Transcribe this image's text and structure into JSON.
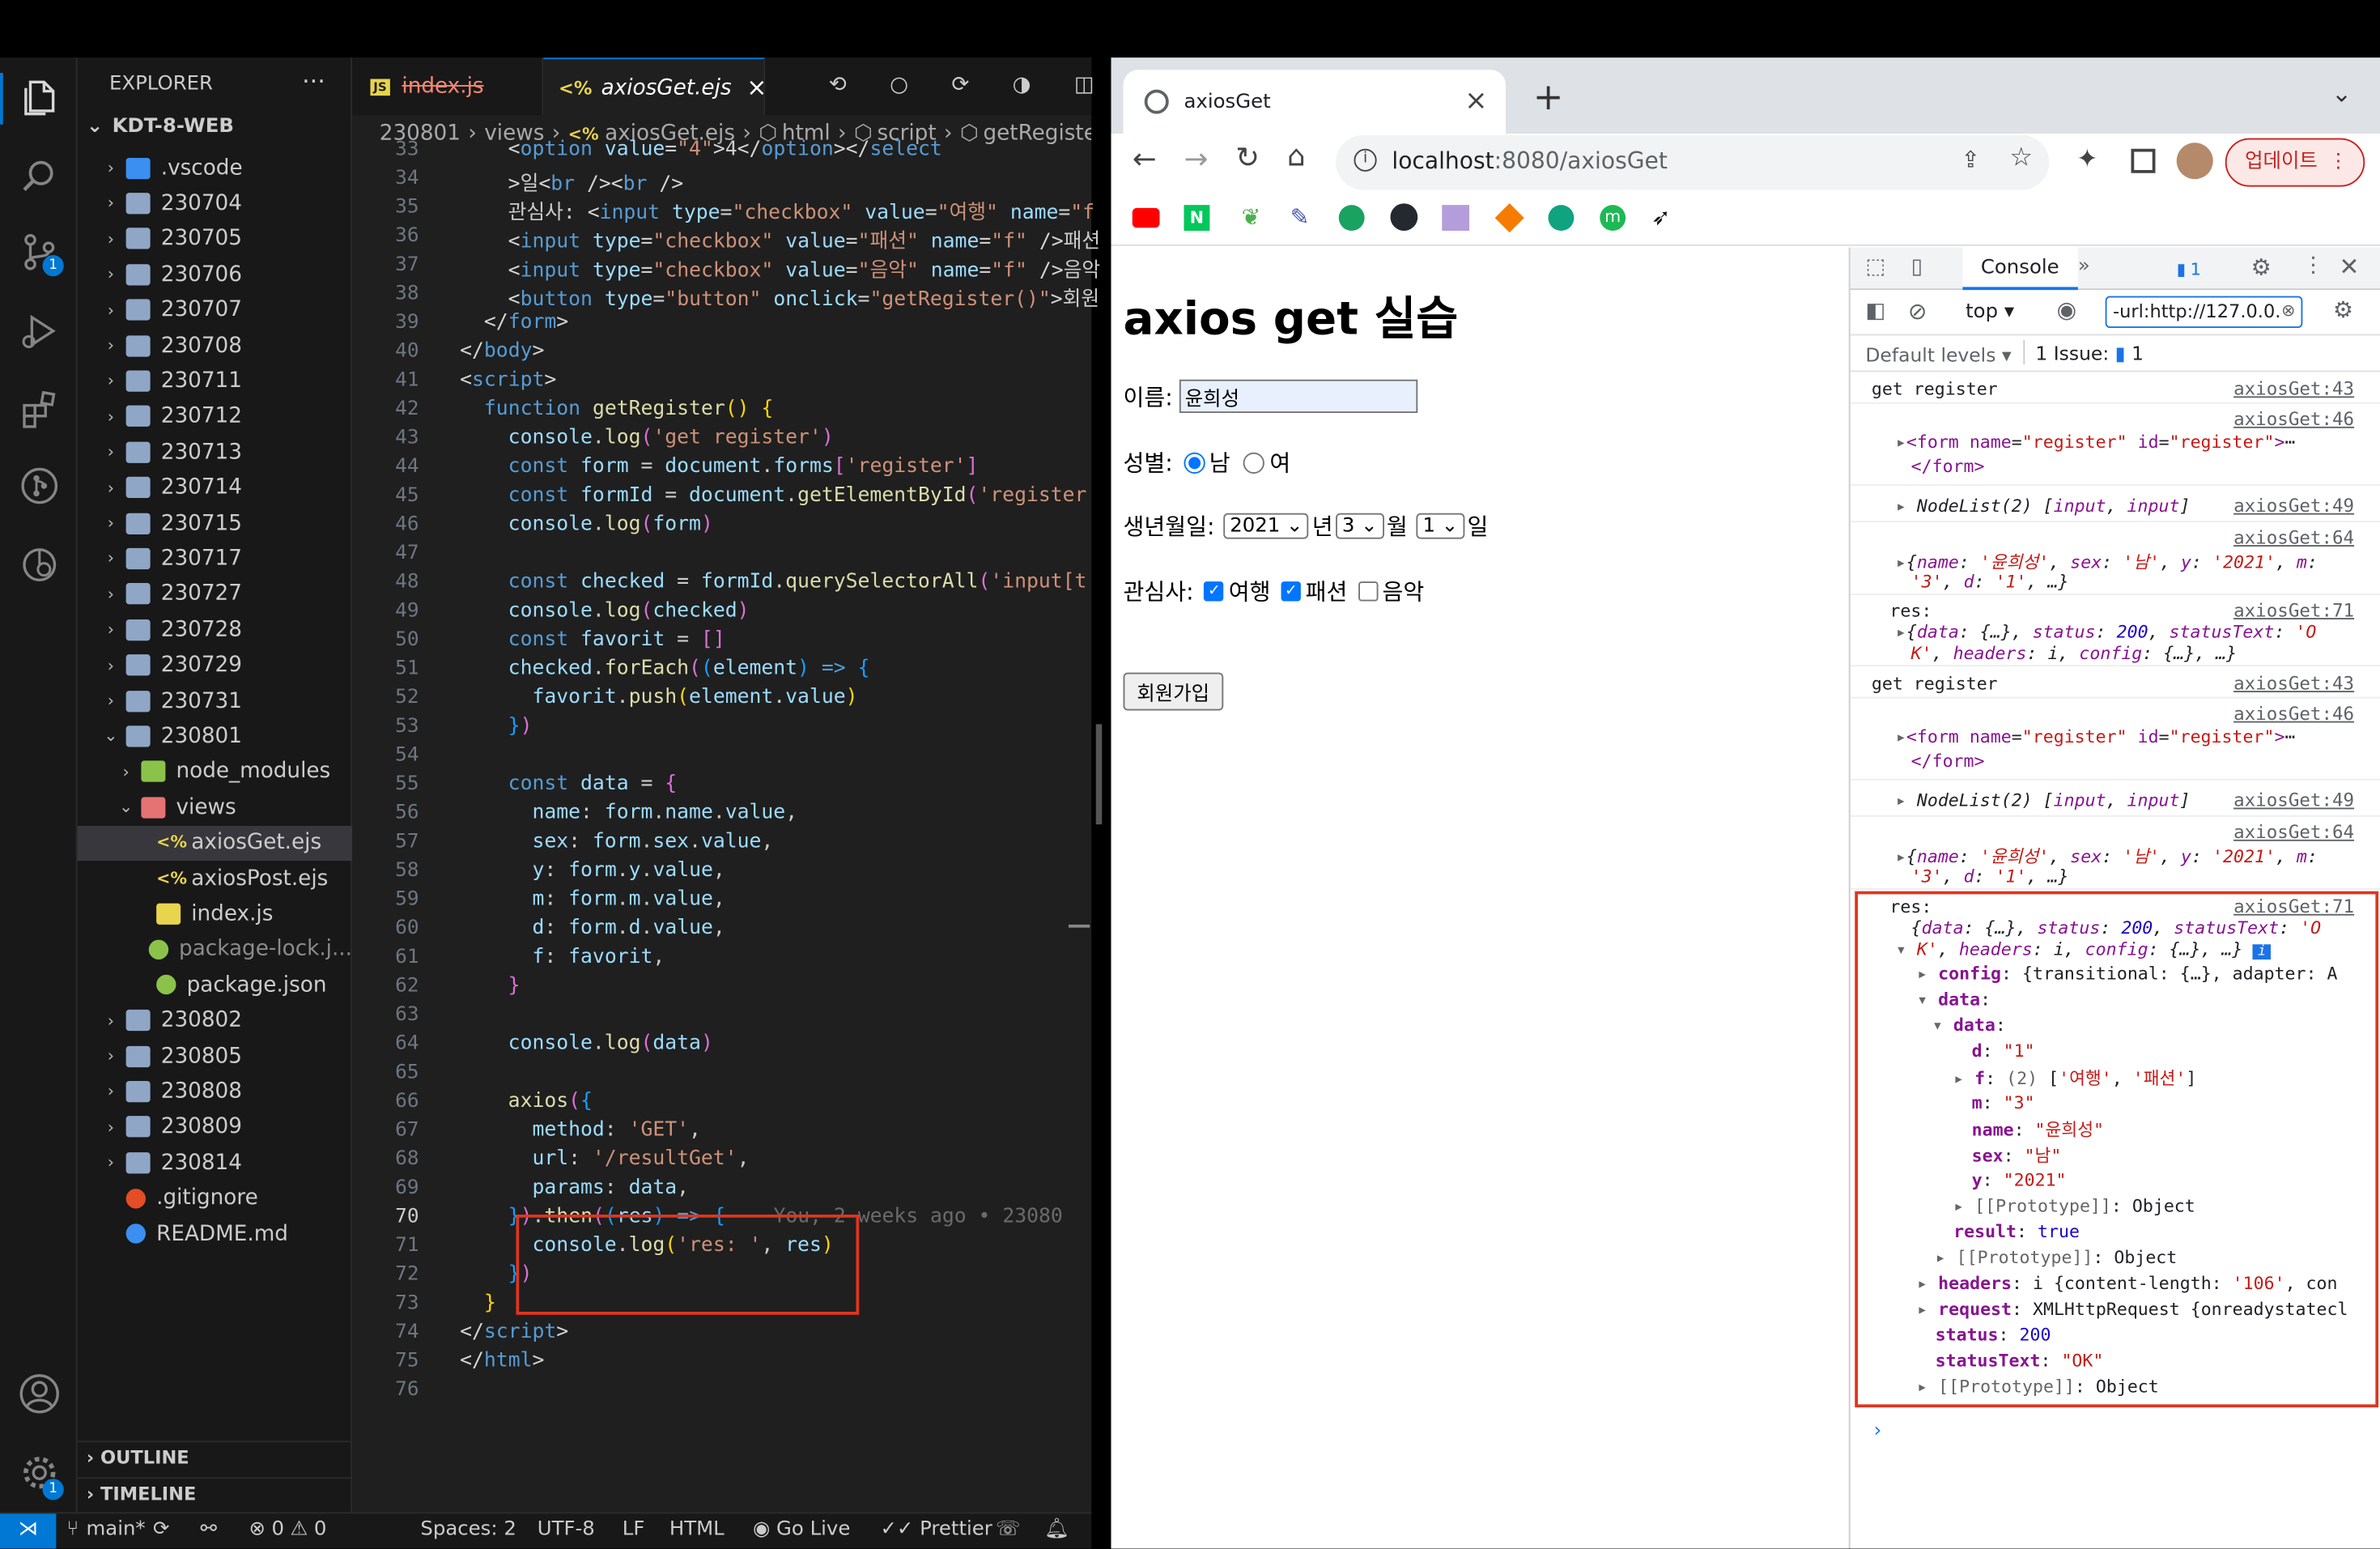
{
  "vscode": {
    "explorer": {
      "title": "EXPLORER",
      "root": "KDT-8-WEB",
      "items": [
        {
          "label": ".vscode",
          "kind": "folder-vscode",
          "depth": 1,
          "open": false
        },
        {
          "label": "230704",
          "kind": "folder",
          "depth": 1,
          "open": false
        },
        {
          "label": "230705",
          "kind": "folder",
          "depth": 1,
          "open": false
        },
        {
          "label": "230706",
          "kind": "folder",
          "depth": 1,
          "open": false
        },
        {
          "label": "230707",
          "kind": "folder",
          "depth": 1,
          "open": false
        },
        {
          "label": "230708",
          "kind": "folder",
          "depth": 1,
          "open": false
        },
        {
          "label": "230711",
          "kind": "folder",
          "depth": 1,
          "open": false
        },
        {
          "label": "230712",
          "kind": "folder",
          "depth": 1,
          "open": false
        },
        {
          "label": "230713",
          "kind": "folder",
          "depth": 1,
          "open": false
        },
        {
          "label": "230714",
          "kind": "folder",
          "depth": 1,
          "open": false
        },
        {
          "label": "230715",
          "kind": "folder",
          "depth": 1,
          "open": false
        },
        {
          "label": "230717",
          "kind": "folder",
          "depth": 1,
          "open": false
        },
        {
          "label": "230727",
          "kind": "folder",
          "depth": 1,
          "open": false
        },
        {
          "label": "230728",
          "kind": "folder",
          "depth": 1,
          "open": false
        },
        {
          "label": "230729",
          "kind": "folder",
          "depth": 1,
          "open": false
        },
        {
          "label": "230731",
          "kind": "folder",
          "depth": 1,
          "open": false
        },
        {
          "label": "230801",
          "kind": "folder",
          "depth": 1,
          "open": true
        },
        {
          "label": "node_modules",
          "kind": "folder-node",
          "depth": 2,
          "open": false
        },
        {
          "label": "views",
          "kind": "folder-views",
          "depth": 2,
          "open": true
        },
        {
          "label": "axiosGet.ejs",
          "kind": "ejs",
          "depth": 3,
          "selected": true
        },
        {
          "label": "axiosPost.ejs",
          "kind": "ejs",
          "depth": 3
        },
        {
          "label": "index.js",
          "kind": "js",
          "depth": 3
        },
        {
          "label": "package-lock.j...",
          "kind": "npm",
          "depth": 3
        },
        {
          "label": "package.json",
          "kind": "npm",
          "depth": 3
        },
        {
          "label": "230802",
          "kind": "folder",
          "depth": 1,
          "open": false
        },
        {
          "label": "230805",
          "kind": "folder",
          "depth": 1,
          "open": false
        },
        {
          "label": "230808",
          "kind": "folder",
          "depth": 1,
          "open": false
        },
        {
          "label": "230809",
          "kind": "folder",
          "depth": 1,
          "open": false
        },
        {
          "label": "230814",
          "kind": "folder",
          "depth": 1,
          "open": false
        },
        {
          "label": ".gitignore",
          "kind": "git",
          "depth": 1
        },
        {
          "label": "README.md",
          "kind": "info",
          "depth": 1
        }
      ],
      "outline": "OUTLINE",
      "timeline": "TIMELINE"
    },
    "tabs": [
      {
        "label": "index.js",
        "icon": "JS"
      },
      {
        "label": "axiosGet.ejs",
        "icon": "<%",
        "close": "×"
      }
    ],
    "breadcrumb": [
      "230801",
      "views",
      "axiosGet.ejs",
      "html",
      "script",
      "getRegiste"
    ],
    "line_numbers": [
      "33",
      "34",
      "35",
      "36",
      "37",
      "38",
      "39",
      "40",
      "41",
      "42",
      "43",
      "44",
      "45",
      "46",
      "47",
      "48",
      "49",
      "50",
      "51",
      "52",
      "53",
      "54",
      "55",
      "56",
      "57",
      "58",
      "59",
      "60",
      "61",
      "62",
      "63",
      "64",
      "65",
      "66",
      "67",
      "68",
      "69",
      "70",
      "71",
      "72",
      "73",
      "74",
      "75",
      "76"
    ],
    "blame": "You, 2 weeks ago • 23080",
    "status": {
      "branch": "main*",
      "errors": "0",
      "warnings": "0",
      "spaces": "Spaces: 2",
      "encoding": "UTF-8",
      "eol": "LF",
      "language": "HTML",
      "golive": "Go Live",
      "prettier": "Prettier"
    },
    "badges": {
      "scm": "1",
      "settings": "1"
    }
  },
  "chrome": {
    "tab_title": "axiosGet",
    "tab_close": "×",
    "new_tab": "+",
    "url_host": "localhost",
    "url_rest": ":8080/axiosGet",
    "update_label": "업데이트",
    "page": {
      "heading": "axios get 실습",
      "name_label": "이름:",
      "name_value": "윤희성",
      "gender_label": "성별:",
      "gender_male": "남",
      "gender_female": "여",
      "birth_label": "생년월일:",
      "year": "2021",
      "year_unit": "년",
      "month": "3",
      "month_unit": "월",
      "day": "1",
      "day_unit": "일",
      "interest_label": "관심사:",
      "interest_travel": "여행",
      "interest_fashion": "패션",
      "interest_music": "음악",
      "submit": "회원가입"
    },
    "devtools": {
      "tab_console": "Console",
      "issues_count": "1",
      "context": "top",
      "filter": "-url:http://127.0.0.",
      "levels": "Default levels",
      "issue_label": "1 Issue:",
      "issue_count": "1"
    }
  }
}
